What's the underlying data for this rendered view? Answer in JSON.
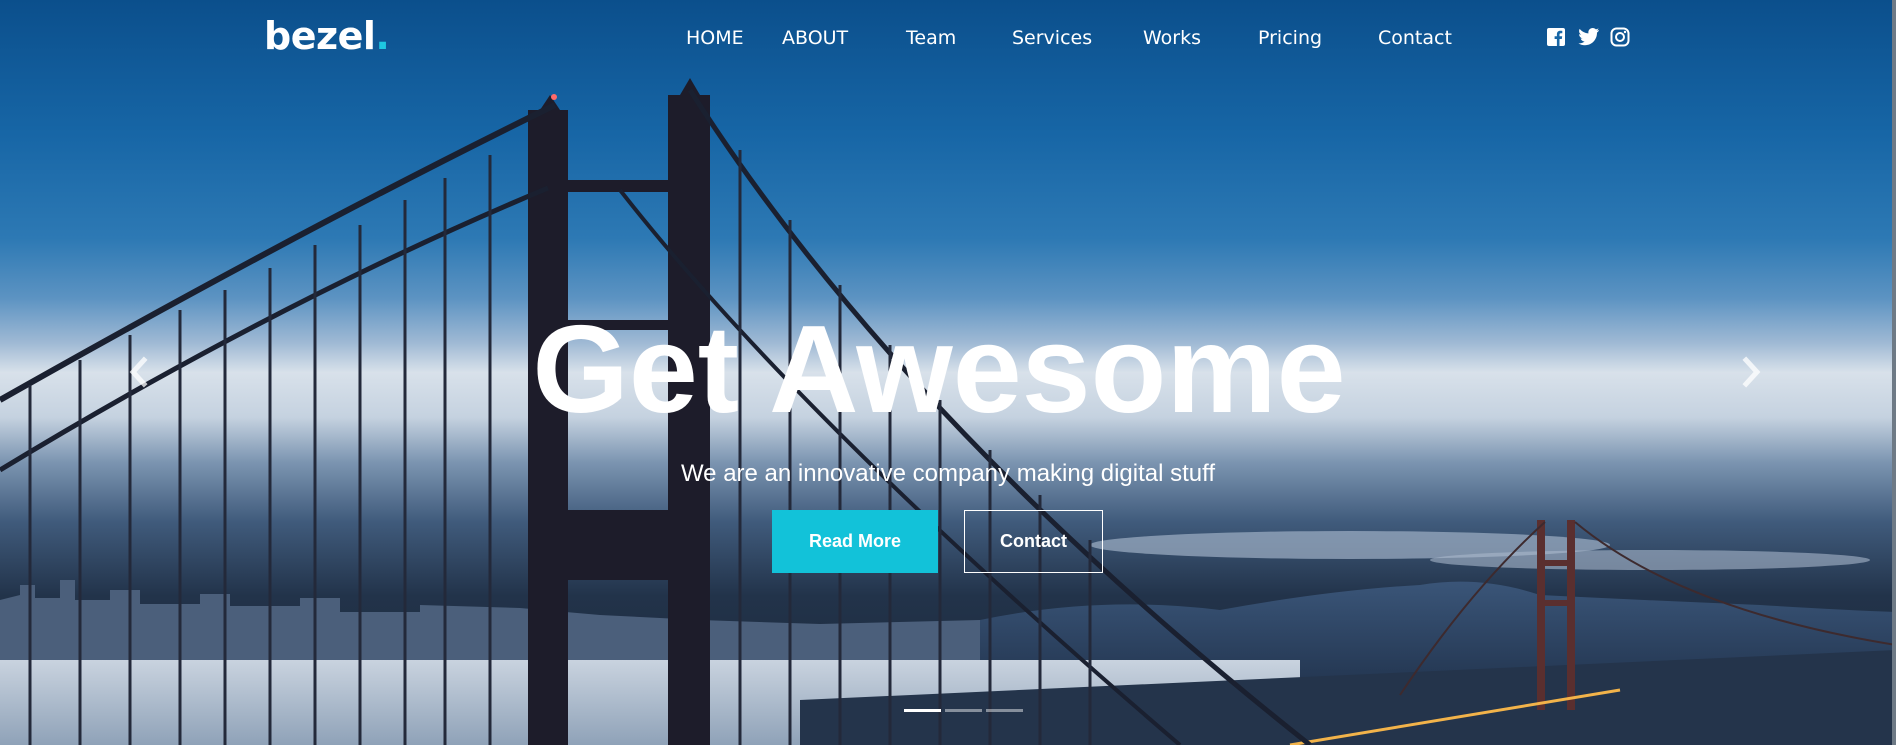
{
  "brand": {
    "name": "bezel",
    "dot": ".",
    "accent": "#1ec8e1"
  },
  "nav": {
    "items": [
      {
        "label": "HOME"
      },
      {
        "label": "ABOUT"
      },
      {
        "label": "Team"
      },
      {
        "label": "Services"
      },
      {
        "label": "Works"
      },
      {
        "label": "Pricing"
      },
      {
        "label": "Contact"
      }
    ],
    "social": [
      "facebook-icon",
      "twitter-icon",
      "instagram-icon"
    ]
  },
  "hero": {
    "title": "Get Awesome",
    "subtitle": "We are an innovative company making digital stuff",
    "primary_button": "Read More",
    "secondary_button": "Contact",
    "prev_icon": "chevron-left-icon",
    "next_icon": "chevron-right-icon",
    "slides": {
      "count": 3,
      "active": 1
    }
  },
  "colors": {
    "primary_button": "#12c2d9",
    "text": "#ffffff"
  }
}
